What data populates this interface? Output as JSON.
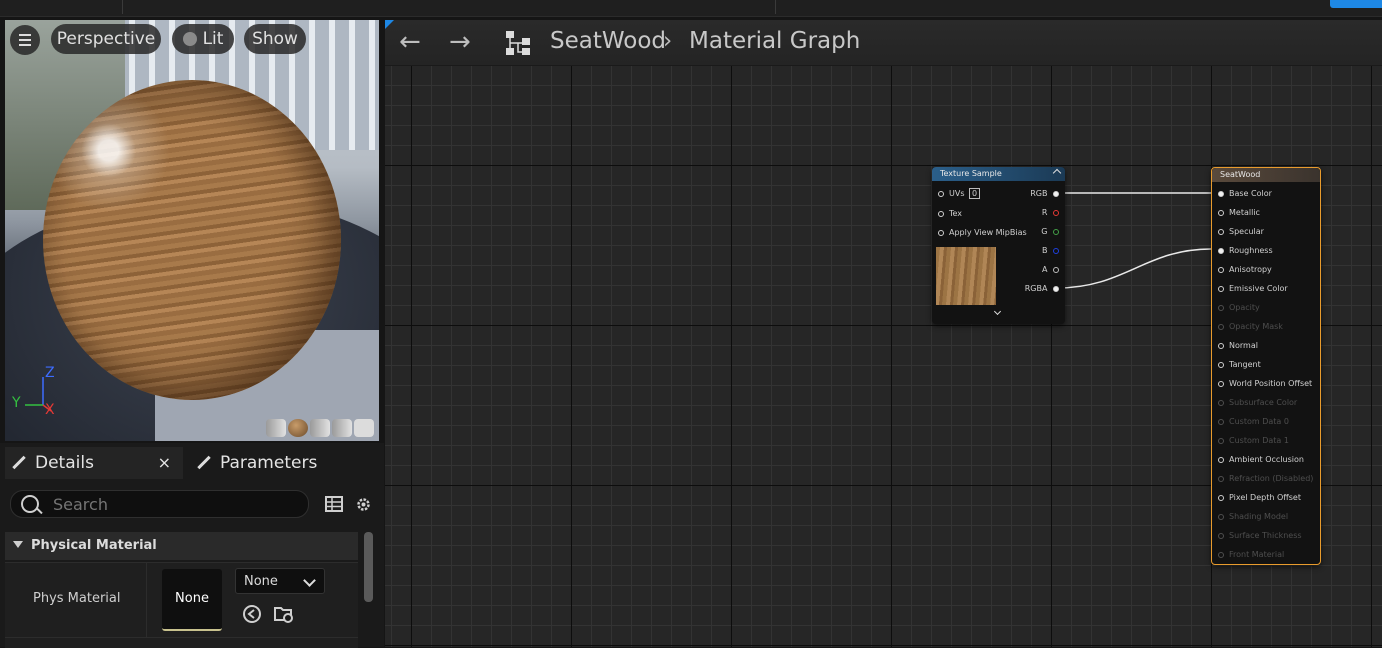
{
  "viewport": {
    "view_mode": "Perspective",
    "lighting": "Lit",
    "show": "Show",
    "axes": {
      "z": "Z",
      "y": "Y",
      "x": "X"
    }
  },
  "details_panel": {
    "tabs": [
      {
        "label": "Details"
      },
      {
        "label": "Parameters"
      }
    ],
    "close_glyph": "×",
    "search": {
      "placeholder": "Search",
      "value": ""
    },
    "section": "Physical Material",
    "property": {
      "label": "Phys Material",
      "thumbnail_value": "None",
      "combo_value": "None"
    }
  },
  "graph": {
    "breadcrumb": [
      "SeatWood",
      "Material Graph"
    ],
    "separator": "›",
    "texture_node": {
      "title": "Texture Sample",
      "inputs": [
        {
          "label": "UVs",
          "value": "0"
        },
        {
          "label": "Tex"
        },
        {
          "label": "Apply View MipBias"
        }
      ],
      "outputs": [
        "RGB",
        "R",
        "G",
        "B",
        "A",
        "RGBA"
      ],
      "output_colors": {
        "R": "#e53935",
        "G": "#43a047",
        "B": "#1e40e0",
        "A": "#bdbdbd"
      }
    },
    "material_node": {
      "title": "SeatWood",
      "pins": [
        {
          "label": "Base Color",
          "enabled": true,
          "connected": true
        },
        {
          "label": "Metallic",
          "enabled": true
        },
        {
          "label": "Specular",
          "enabled": true
        },
        {
          "label": "Roughness",
          "enabled": true,
          "connected": true
        },
        {
          "label": "Anisotropy",
          "enabled": true
        },
        {
          "label": "Emissive Color",
          "enabled": true
        },
        {
          "label": "Opacity",
          "enabled": false
        },
        {
          "label": "Opacity Mask",
          "enabled": false
        },
        {
          "label": "Normal",
          "enabled": true
        },
        {
          "label": "Tangent",
          "enabled": true
        },
        {
          "label": "World Position Offset",
          "enabled": true
        },
        {
          "label": "Subsurface Color",
          "enabled": false
        },
        {
          "label": "Custom Data 0",
          "enabled": false
        },
        {
          "label": "Custom Data 1",
          "enabled": false
        },
        {
          "label": "Ambient Occlusion",
          "enabled": true
        },
        {
          "label": "Refraction (Disabled)",
          "enabled": false
        },
        {
          "label": "Pixel Depth Offset",
          "enabled": true
        },
        {
          "label": "Shading Model",
          "enabled": false
        },
        {
          "label": "Surface Thickness",
          "enabled": false
        },
        {
          "label": "Front Material",
          "enabled": false
        }
      ]
    }
  },
  "colors": {
    "accent": "#1e88e5",
    "node_border_selected": "#e89b2d",
    "texture_header": "#2b5f8a"
  }
}
